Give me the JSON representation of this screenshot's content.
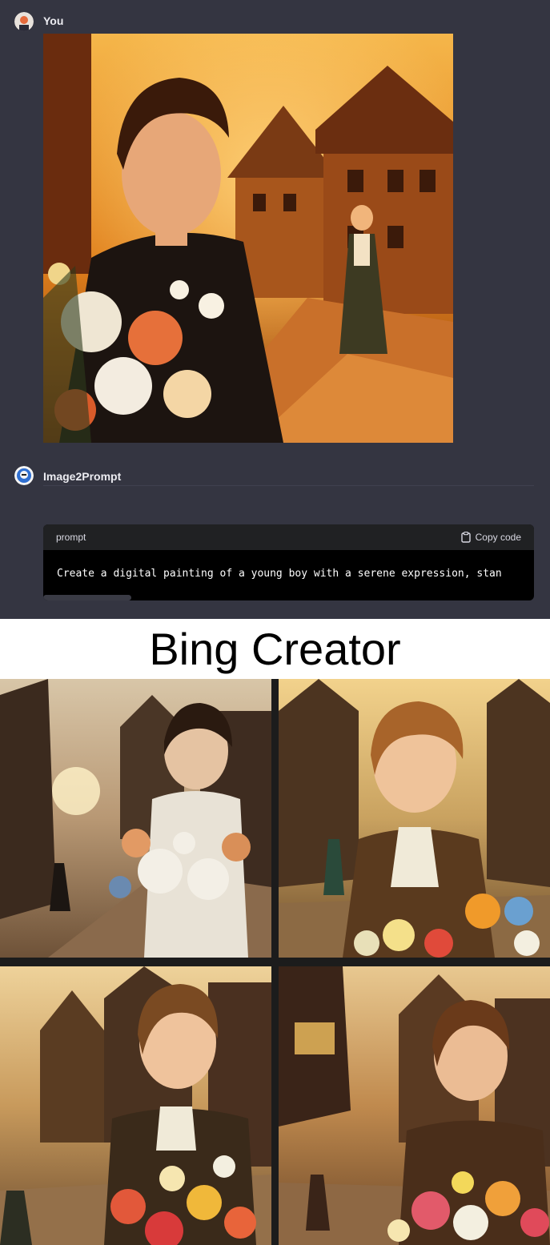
{
  "user": {
    "name": "You",
    "avatar_icon": "user-avatar"
  },
  "assistant": {
    "name": "Image2Prompt",
    "avatar_icon": "bot-avatar"
  },
  "code_block": {
    "language": "prompt",
    "copy_label": "Copy code",
    "copy_icon": "clipboard-icon",
    "text": "Create a digital painting of a young boy with a serene expression, stan"
  },
  "banner": {
    "title": "Bing Creator"
  },
  "colors": {
    "chat_bg": "#343541",
    "code_header": "#202123",
    "code_bg": "#000000",
    "warm": "#e08a1e"
  }
}
